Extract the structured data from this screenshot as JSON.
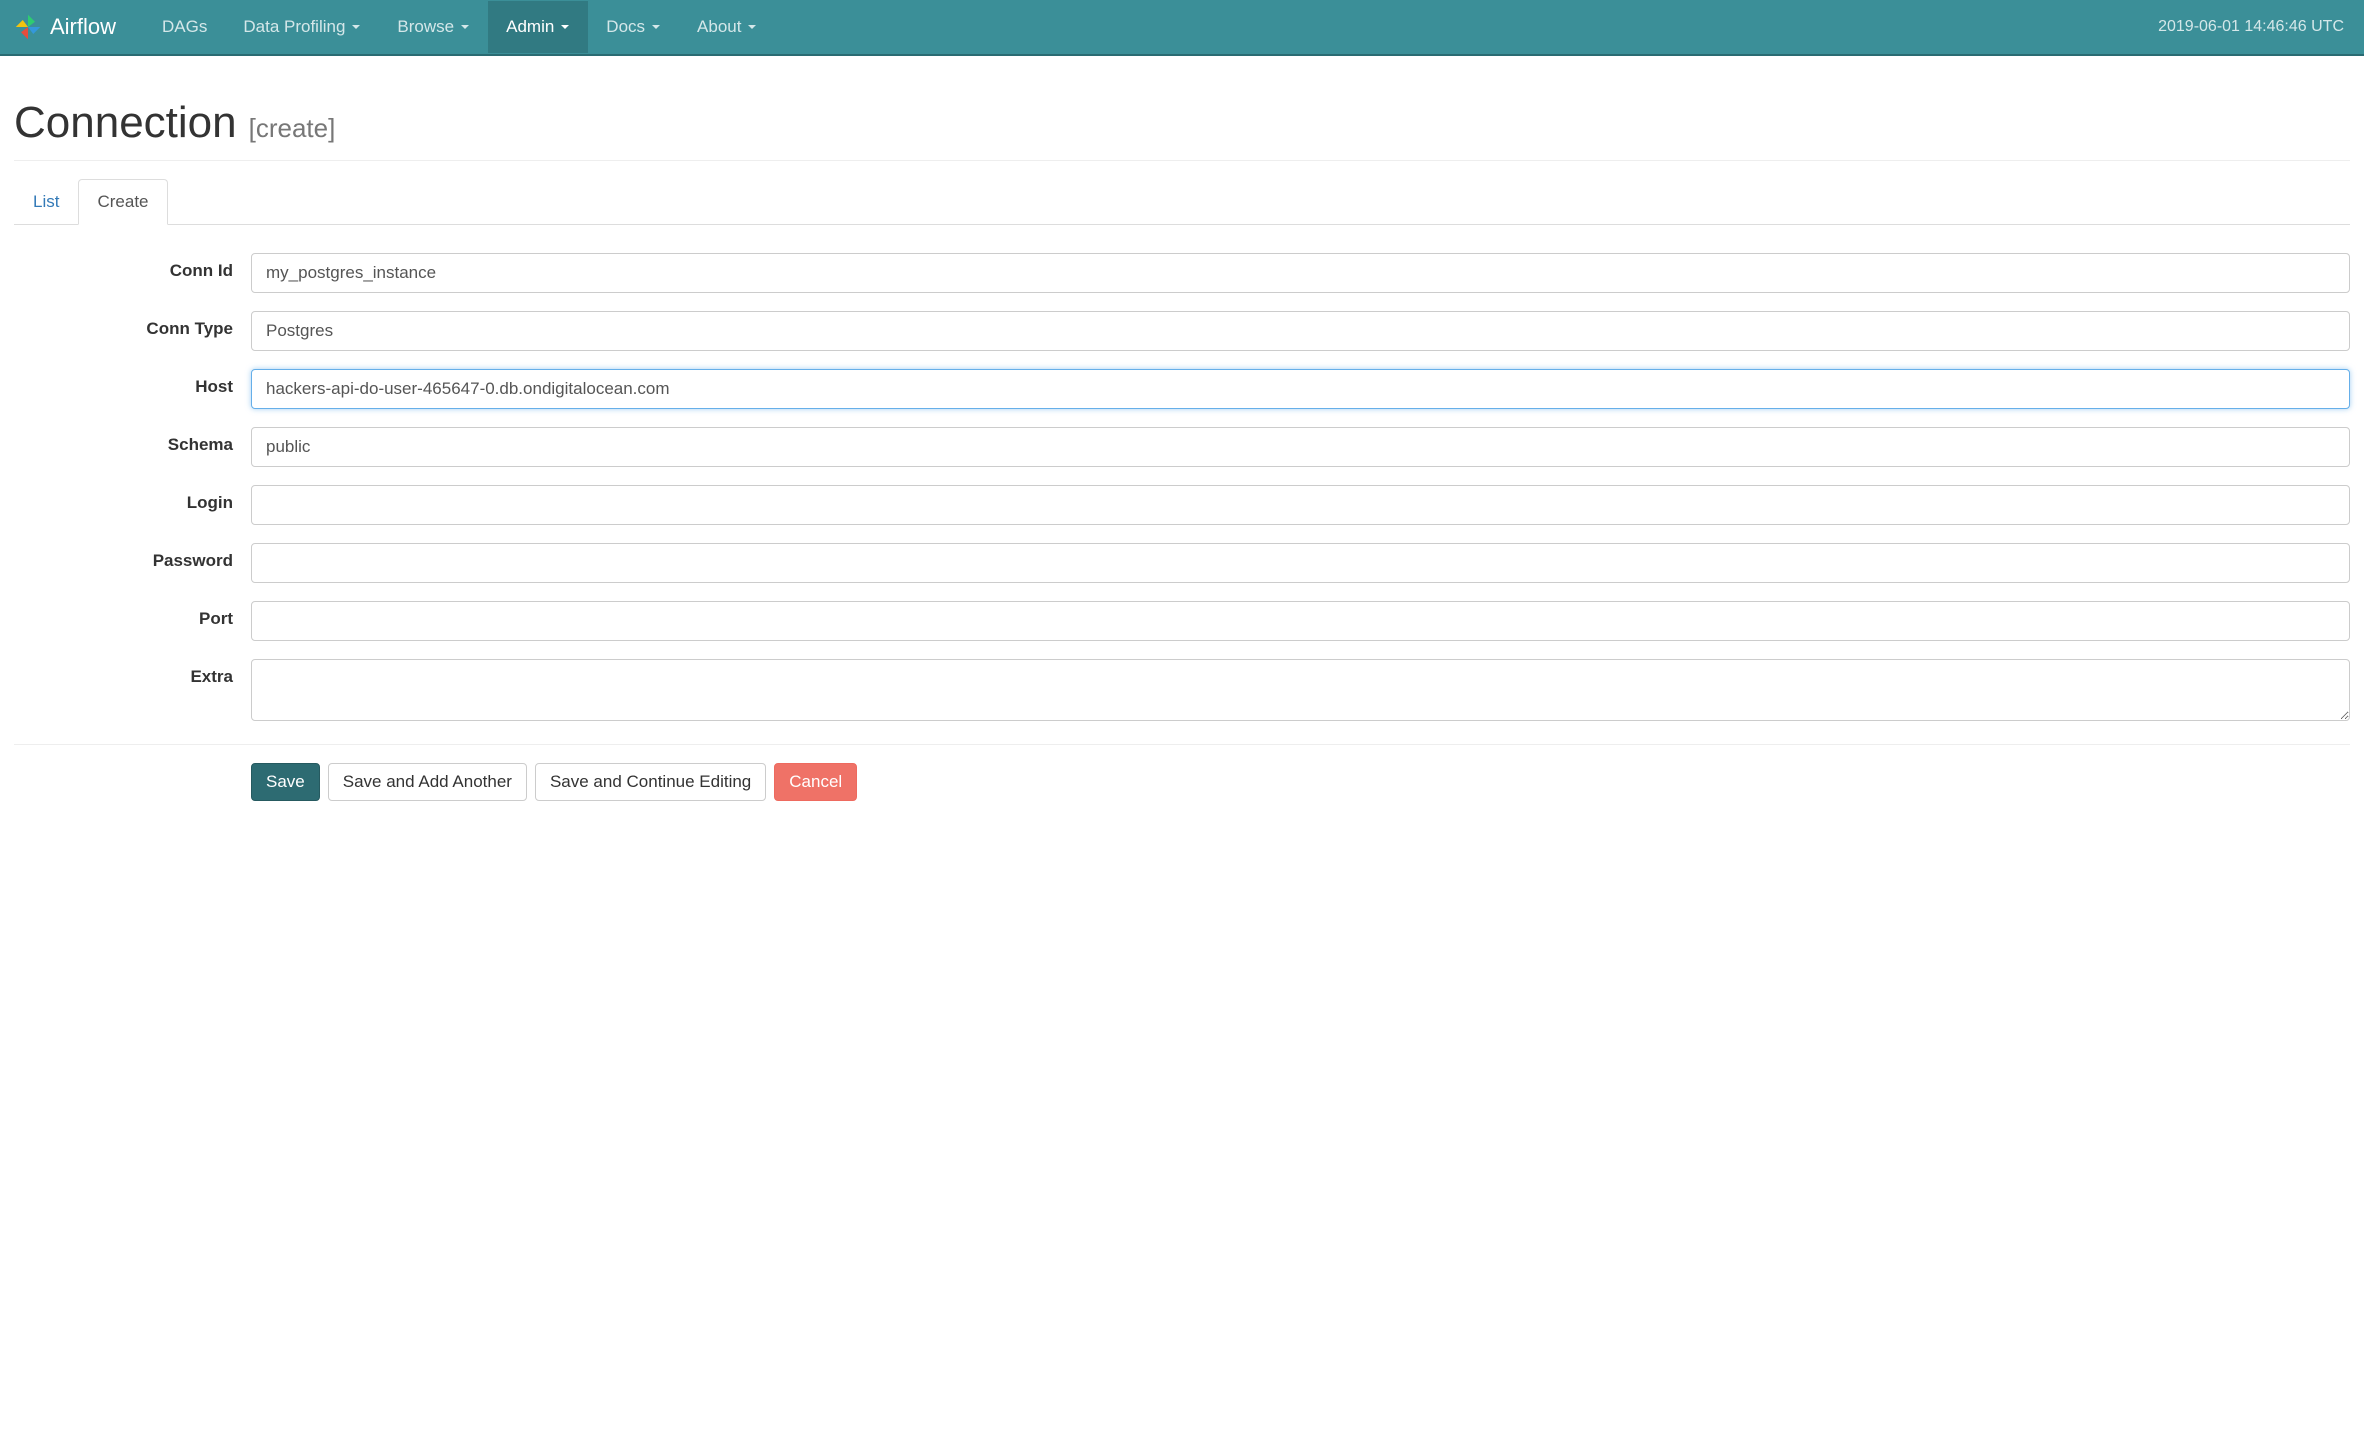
{
  "navbar": {
    "brand": "Airflow",
    "items": [
      {
        "label": "DAGs",
        "caret": false
      },
      {
        "label": "Data Profiling",
        "caret": true
      },
      {
        "label": "Browse",
        "caret": true
      },
      {
        "label": "Admin",
        "caret": true,
        "active": true
      },
      {
        "label": "Docs",
        "caret": true
      },
      {
        "label": "About",
        "caret": true
      }
    ],
    "timestamp": "2019-06-01 14:46:46 UTC"
  },
  "page": {
    "title": "Connection",
    "subtitle": "[create]"
  },
  "tabs": {
    "list": "List",
    "create": "Create"
  },
  "form": {
    "fields": {
      "conn_id": {
        "label": "Conn Id",
        "value": "my_postgres_instance"
      },
      "conn_type": {
        "label": "Conn Type",
        "value": "Postgres"
      },
      "host": {
        "label": "Host",
        "value": "hackers-api-do-user-465647-0.db.ondigitalocean.com"
      },
      "schema": {
        "label": "Schema",
        "value": "public"
      },
      "login": {
        "label": "Login",
        "value": ""
      },
      "password": {
        "label": "Password",
        "value": ""
      },
      "port": {
        "label": "Port",
        "value": ""
      },
      "extra": {
        "label": "Extra",
        "value": ""
      }
    },
    "buttons": {
      "save": "Save",
      "save_add": "Save and Add Another",
      "save_continue": "Save and Continue Editing",
      "cancel": "Cancel"
    }
  }
}
